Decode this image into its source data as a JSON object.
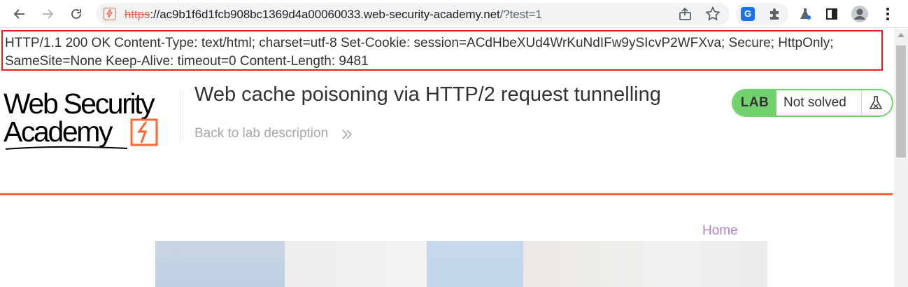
{
  "browser": {
    "url_protocol": "https",
    "url_host": "://ac9b1f6d1fcb908bc1369d4a00060033.web-security-academy.net",
    "url_path": "/?test=1",
    "extension_letter": "G"
  },
  "response_headers": {
    "text": "HTTP/1.1 200 OK Content-Type: text/html; charset=utf-8 Set-Cookie: session=ACdHbeXUd4WrKuNdIFw9ySIcvP2WFXva; Secure; HttpOnly; SameSite=None Keep-Alive: timeout=0 Content-Length: 9481"
  },
  "header": {
    "logo_line1": "Web Security",
    "logo_line2": "Academy",
    "lab_title": "Web cache poisoning via HTTP/2 request tunnelling",
    "back_link": "Back to lab description"
  },
  "lab_status": {
    "badge_label": "LAB",
    "status": "Not solved",
    "accent_color": "#70d16d"
  },
  "nav": {
    "home": "Home"
  },
  "colors": {
    "accent_orange": "#ff6633",
    "link_purple": "#b27fcc",
    "highlight_red": "#e02020"
  }
}
